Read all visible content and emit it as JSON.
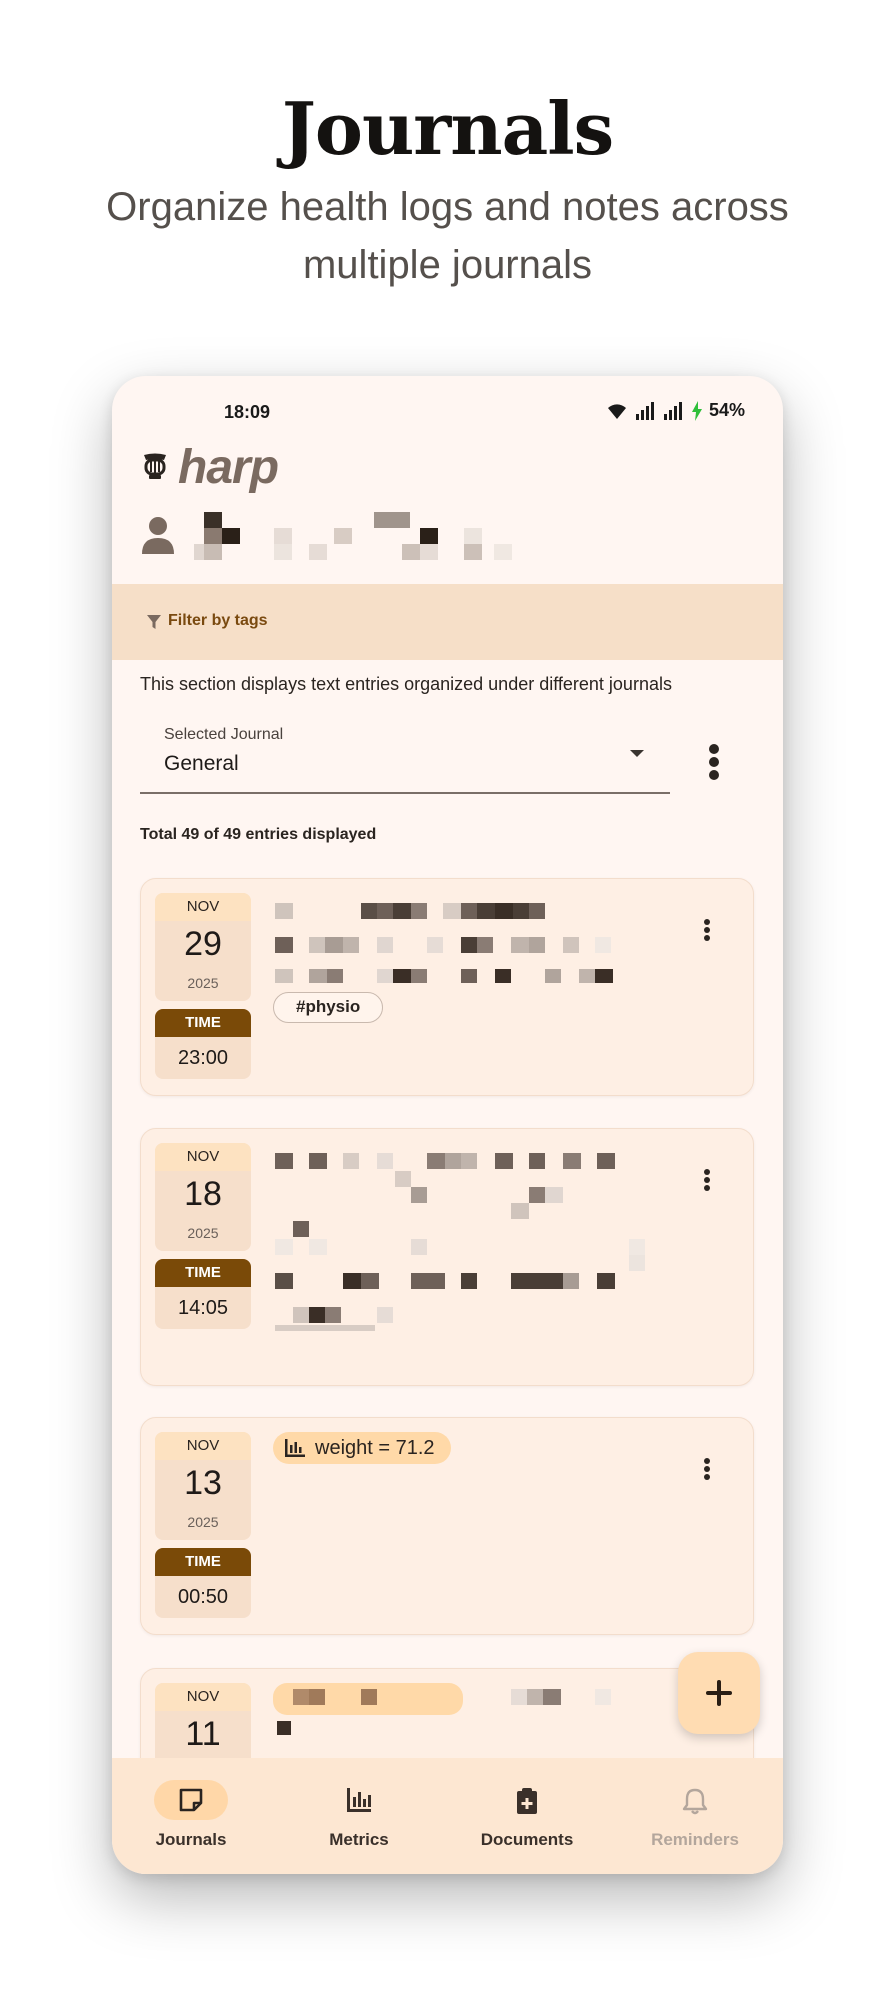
{
  "promo": {
    "title": "Journals",
    "subtitle": "Organize health logs and notes across multiple journals"
  },
  "status_bar": {
    "time": "18:09",
    "battery": "54%"
  },
  "app": {
    "logo": "harp"
  },
  "filter": {
    "label": "Filter by tags"
  },
  "journal_section": {
    "description": "This section displays text entries organized under different journals",
    "select_label": "Selected Journal",
    "selected_journal": "General",
    "total": "Total 49 of 49 entries displayed"
  },
  "entries": [
    {
      "month": "NOV",
      "day": "29",
      "year": "2025",
      "time_label": "TIME",
      "time": "23:00",
      "tag": "#physio"
    },
    {
      "month": "NOV",
      "day": "18",
      "year": "2025",
      "time_label": "TIME",
      "time": "14:05"
    },
    {
      "month": "NOV",
      "day": "13",
      "year": "2025",
      "time_label": "TIME",
      "time": "00:50",
      "metric": "weight = 71.2"
    },
    {
      "month": "NOV",
      "day": "11"
    }
  ],
  "nav": {
    "items": [
      {
        "label": "Journals",
        "icon": "note-icon",
        "active": true
      },
      {
        "label": "Metrics",
        "icon": "bar-chart-icon",
        "active": false
      },
      {
        "label": "Documents",
        "icon": "clipboard-plus-icon",
        "active": false
      },
      {
        "label": "Reminders",
        "icon": "bell-icon",
        "active": false,
        "disabled": true
      }
    ]
  },
  "colors": {
    "accent": "#7a4a08",
    "filter_bg": "#f6dfc8",
    "card_bg": "#feefe4",
    "nav_bg": "#fde7d2",
    "fab_bg": "#ffdcb2"
  }
}
